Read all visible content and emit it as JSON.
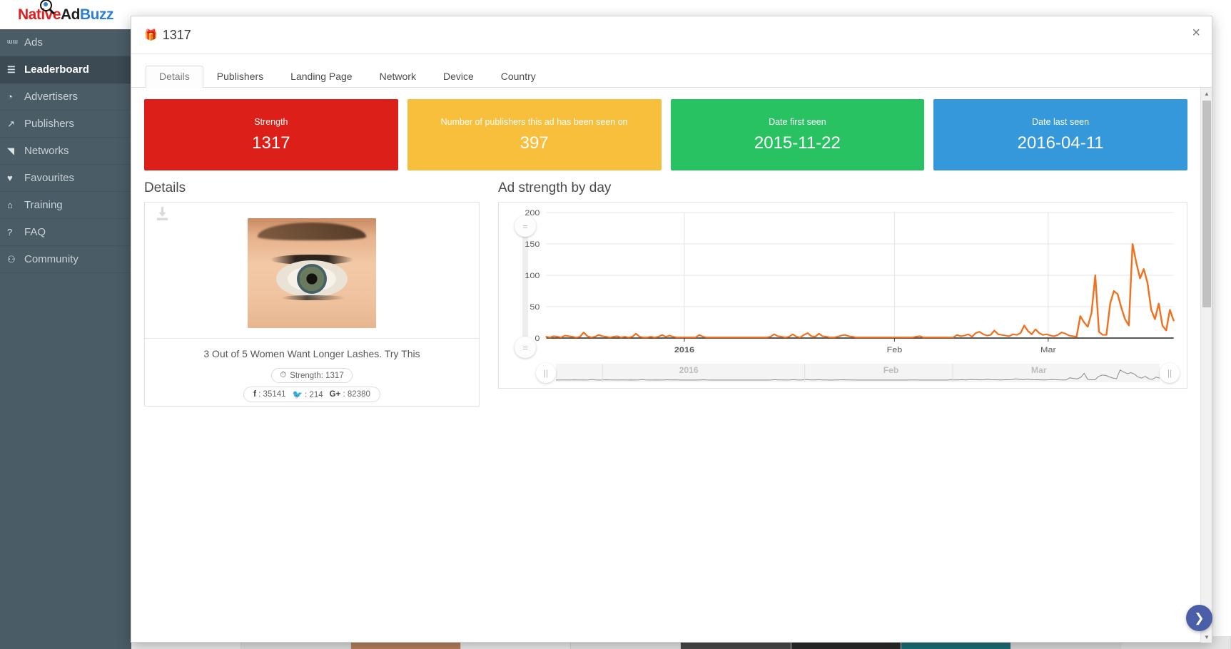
{
  "brand": {
    "part1": "Native",
    "part2": "Ad",
    "part3": "Buzz"
  },
  "sidebar": {
    "items": [
      {
        "label": "Ads",
        "icon": "bar-chart-icon",
        "glyph": "ᵚᵚ",
        "active": false
      },
      {
        "label": "Leaderboard",
        "icon": "list-ol-icon",
        "glyph": "☰",
        "active": true
      },
      {
        "label": "Advertisers",
        "icon": "pie-chart-icon",
        "glyph": "◔",
        "active": false
      },
      {
        "label": "Publishers",
        "icon": "line-chart-icon",
        "glyph": "↗",
        "active": false
      },
      {
        "label": "Networks",
        "icon": "area-chart-icon",
        "glyph": "◥",
        "active": false
      },
      {
        "label": "Favourites",
        "icon": "heart-icon",
        "glyph": "♥",
        "active": false
      },
      {
        "label": "Training",
        "icon": "bank-icon",
        "glyph": "⌂",
        "active": false
      },
      {
        "label": "FAQ",
        "icon": "question-circle-icon",
        "glyph": "?",
        "active": false
      },
      {
        "label": "Community",
        "icon": "users-icon",
        "glyph": "⚇",
        "active": false
      }
    ]
  },
  "modal": {
    "title": "1317",
    "title_icon": "gift-icon",
    "close_label": "×",
    "tabs": [
      {
        "label": "Details",
        "active": true
      },
      {
        "label": "Publishers",
        "active": false
      },
      {
        "label": "Landing Page",
        "active": false
      },
      {
        "label": "Network",
        "active": false
      },
      {
        "label": "Device",
        "active": false
      },
      {
        "label": "Country",
        "active": false
      }
    ],
    "stat_cards": [
      {
        "label": "Strength",
        "value": "1317",
        "color": "#dc2019"
      },
      {
        "label": "Number of publishers this ad has been seen on",
        "value": "397",
        "color": "#f7bf3c"
      },
      {
        "label": "Date first seen",
        "value": "2015-11-22",
        "color": "#28c263"
      },
      {
        "label": "Date last seen",
        "value": "2016-04-11",
        "color": "#3498db"
      }
    ],
    "details": {
      "heading": "Details",
      "download_icon": "download-icon",
      "headline": "3 Out of 5 Women Want Longer Lashes. Try This",
      "strength_badge": {
        "icon": "clock-icon",
        "text": "Strength: 1317"
      },
      "social": [
        {
          "icon": "facebook-icon",
          "glyph": "f",
          "value": "35141"
        },
        {
          "icon": "twitter-icon",
          "glyph": "🐦",
          "value": "214"
        },
        {
          "icon": "google-plus-icon",
          "glyph": "G+",
          "value": "82380"
        }
      ]
    },
    "chart_panel": {
      "heading": "Ad strength by day",
      "slider_handle_icon": "slider-handle-icon",
      "navigator_handle_icon": "pause-handle-icon",
      "navigator_labels": [
        "2016",
        "Feb",
        "Mar"
      ]
    },
    "scrollbar": {
      "up_icon": "caret-up-icon",
      "down_icon": "caret-down-icon"
    }
  },
  "fab": {
    "icon": "chevron-down-icon",
    "glyph": "❯"
  },
  "chart_data": {
    "type": "line",
    "title": "Ad strength by day",
    "xlabel": "",
    "ylabel": "",
    "ylim": [
      0,
      200
    ],
    "yticks": [
      0,
      50,
      100,
      150,
      200
    ],
    "xticks": [
      "2016",
      "Feb",
      "Mar"
    ],
    "grid": true,
    "legend": "none",
    "series_color": "#f2701d",
    "series": [
      {
        "name": "Ad strength",
        "values": [
          2,
          1,
          3,
          2,
          1,
          4,
          3,
          2,
          1,
          2,
          9,
          3,
          1,
          2,
          5,
          3,
          2,
          1,
          2,
          3,
          1,
          2,
          1,
          2,
          7,
          2,
          1,
          1,
          2,
          1,
          2,
          5,
          2,
          4,
          2,
          1,
          1,
          1,
          1,
          1,
          1,
          5,
          2,
          1,
          1,
          1,
          1,
          1,
          1,
          1,
          1,
          1,
          1,
          1,
          1,
          1,
          1,
          1,
          1,
          1,
          2,
          6,
          3,
          2,
          1,
          2,
          6,
          2,
          1,
          5,
          8,
          3,
          2,
          7,
          3,
          2,
          1,
          1,
          2,
          4,
          5,
          3,
          2,
          1,
          1,
          1,
          1,
          1,
          1,
          1,
          1,
          1,
          1,
          1,
          1,
          1,
          1,
          1,
          1,
          2,
          3,
          1,
          1,
          1,
          1,
          1,
          1,
          1,
          1,
          1,
          5,
          3,
          4,
          6,
          2,
          8,
          10,
          6,
          4,
          5,
          12,
          6,
          5,
          4,
          3,
          6,
          5,
          8,
          20,
          11,
          6,
          14,
          8,
          5,
          6,
          4,
          3,
          5,
          9,
          7,
          4,
          3,
          2,
          35,
          25,
          18,
          40,
          100,
          10,
          5,
          5,
          55,
          75,
          70,
          48,
          30,
          20,
          150,
          120,
          95,
          110,
          88,
          45,
          30,
          55,
          20,
          12,
          45,
          28
        ]
      }
    ],
    "navigator_visible_range": "2015-11-22 to 2016-04-11"
  }
}
